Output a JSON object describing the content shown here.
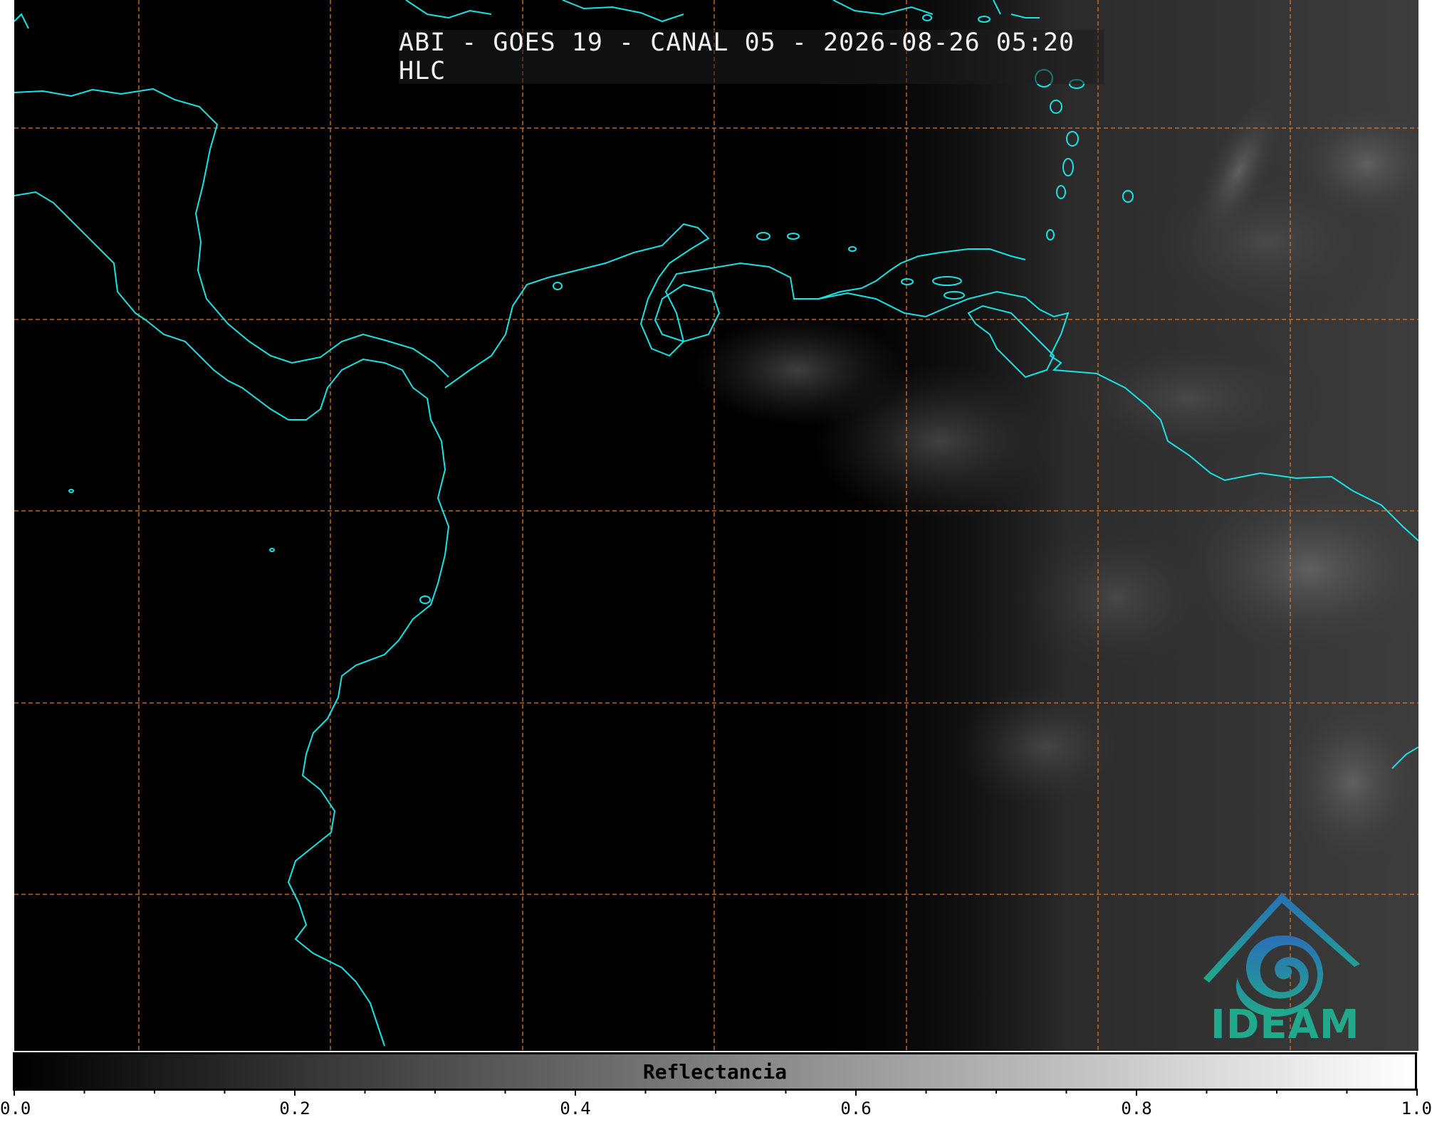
{
  "title": "ABI - GOES 19 - CANAL 05 - 2026-08-26 05:20 HLC",
  "colorbar": {
    "label": "Reflectancia",
    "ticks": [
      "0.0",
      "0.2",
      "0.4",
      "0.6",
      "0.8",
      "1.0"
    ],
    "range": [
      0,
      1
    ]
  },
  "logo": {
    "text": "IDEAM",
    "icon": "ideam-logo-icon"
  },
  "colors": {
    "coastline": "#19e3e3",
    "gridline": "#d9782a",
    "background": "#000000",
    "logo_text": "#22a88a"
  }
}
